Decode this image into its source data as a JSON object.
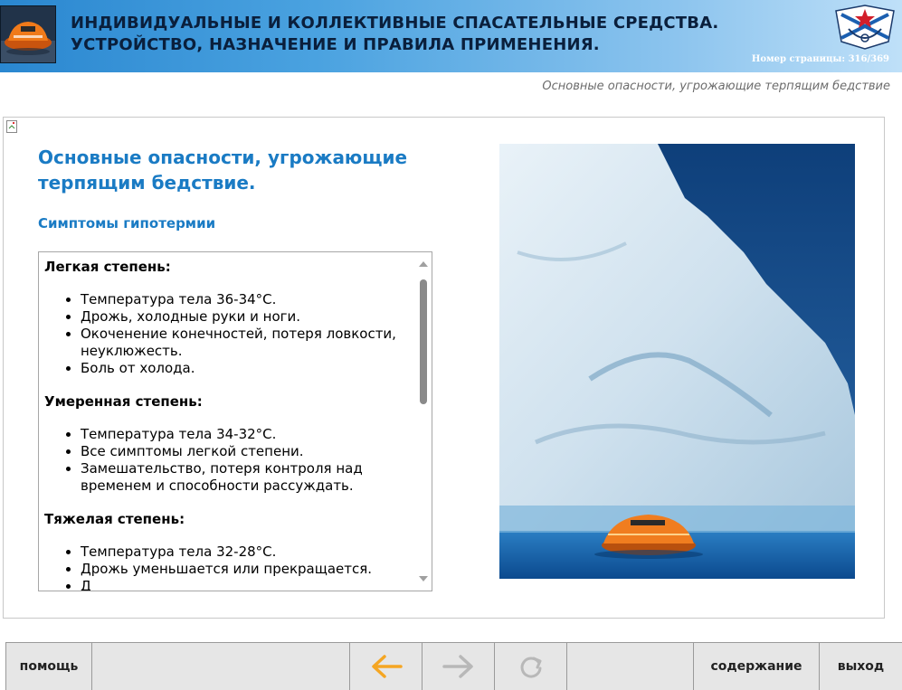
{
  "header": {
    "title_line1": "ИНДИВИДУАЛЬНЫЕ И КОЛЛЕКТИВНЫЕ СПАСАТЕЛЬНЫЕ СРЕДСТВА.",
    "title_line2": "УСТРОЙСТВО, НАЗНАЧЕНИЕ И ПРАВИЛА ПРИМЕНЕНИЯ.",
    "page_number": "Номер страницы: 316/369"
  },
  "topic_crumb": "Основные опасности, угрожающие терпящим бедствие",
  "content": {
    "heading_line1": "Основные опасности, угрожающие",
    "heading_line2": "терпящим бедствие.",
    "subheading": "Симптомы гипотермии",
    "sections": [
      {
        "title": "Легкая степень:",
        "items": [
          "Температура тела 36-34°С.",
          "Дрожь, холодные руки и ноги.",
          "Окоченение конечностей, потеря ловкости, неуклюжесть.",
          "Боль от холода."
        ]
      },
      {
        "title": "Умеренная степень:",
        "items": [
          "Температура тела 34-32°С.",
          "Все симптомы легкой степени.",
          "Замешательство, потеря контроля над временем и способности рассуждать."
        ]
      },
      {
        "title": "Тяжелая степень:",
        "items": [
          "Температура тела 32-28°С.",
          "Дрожь уменьшается или прекращается.",
          "Д"
        ]
      }
    ]
  },
  "navbar": {
    "help_label": "помощь",
    "contents_label": "содержание",
    "exit_label": "выход"
  },
  "colors": {
    "accent": "#1a7bc4",
    "back_arrow": "#f5a623",
    "disabled_arrow": "#b8b8b8",
    "header_text": "#0a1f3c"
  },
  "icons": [
    "raft-logo-icon",
    "navy-emblem-icon",
    "broken-image-icon",
    "arrow-left-icon",
    "arrow-right-icon",
    "replay-icon"
  ]
}
